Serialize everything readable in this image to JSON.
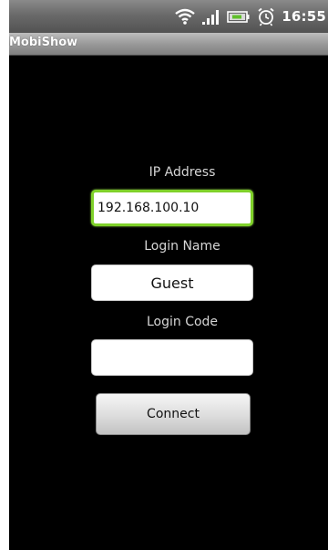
{
  "status_bar": {
    "time": "16:55",
    "icons": [
      "wifi-icon",
      "signal-icon",
      "battery-icon",
      "alarm-icon"
    ]
  },
  "app": {
    "title": "MobiShow"
  },
  "form": {
    "ip_label": "IP Address",
    "ip_value": "192.168.100.10",
    "login_name_label": "Login Name",
    "login_name_value": "Guest",
    "login_code_label": "Login Code",
    "login_code_value": "",
    "connect_label": "Connect"
  },
  "colors": {
    "background": "#000000",
    "focus_border": "#7fd12a",
    "label_text": "#d6d6d6"
  }
}
